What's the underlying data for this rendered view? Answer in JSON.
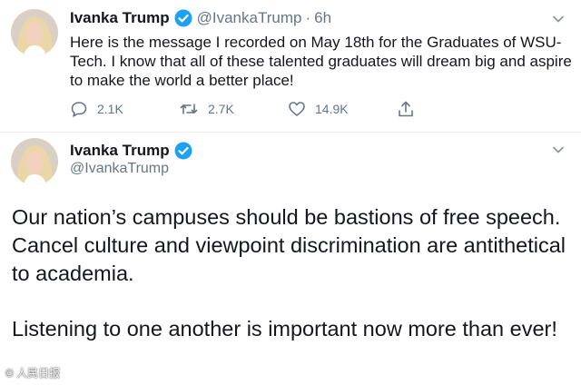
{
  "reply_tweet": {
    "display_name": "Ivanka Trump",
    "handle": "@IvankaTrump",
    "separator": "·",
    "time": "6h",
    "text": "Here is the message I recorded on May 18th for the Graduates of WSU-Tech. I know that all of these talented graduates will dream big and aspire to make the world a better place!",
    "reply_count": "2.1K",
    "retweet_count": "2.7K",
    "like_count": "14.9K"
  },
  "focus_tweet": {
    "display_name": "Ivanka Trump",
    "handle": "@IvankaTrump",
    "paragraph_1": "Our nation’s campuses should be bastions of free speech. Cancel culture and viewpoint discrimination are antithetical to academia.",
    "paragraph_2": "Listening to one another is important now more than ever!"
  },
  "watermark": "© 人民日报",
  "colors": {
    "text": "#14171a",
    "secondary": "#657786",
    "verified": "#1da1f2",
    "divider": "#e6ecf0"
  },
  "icons": [
    "verified-icon",
    "caret-down-icon",
    "reply-icon",
    "retweet-icon",
    "like-icon",
    "share-icon"
  ]
}
